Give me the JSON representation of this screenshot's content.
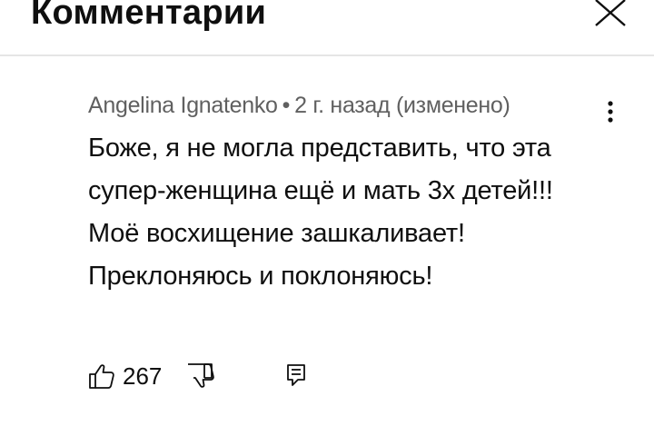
{
  "header": {
    "title": "Комментарии",
    "close_icon": "close-icon"
  },
  "comment": {
    "author": "Angelina Ignatenko",
    "separator": "•",
    "time": "2 г. назад (изменено)",
    "text": "Боже, я не могла представить, что эта супер-женщина ещё и мать 3х детей!!! Моё восхищение зашкаливает! Преклоняюсь и поклоняюсь!",
    "likes": "267",
    "icons": {
      "more": "more-vert-icon",
      "like": "thumb-up-icon",
      "dislike": "thumb-down-icon",
      "reply": "reply-icon"
    }
  },
  "colors": {
    "text": "#0f0f0f",
    "secondary": "#606060",
    "divider": "#e5e5e5",
    "background": "#ffffff"
  }
}
